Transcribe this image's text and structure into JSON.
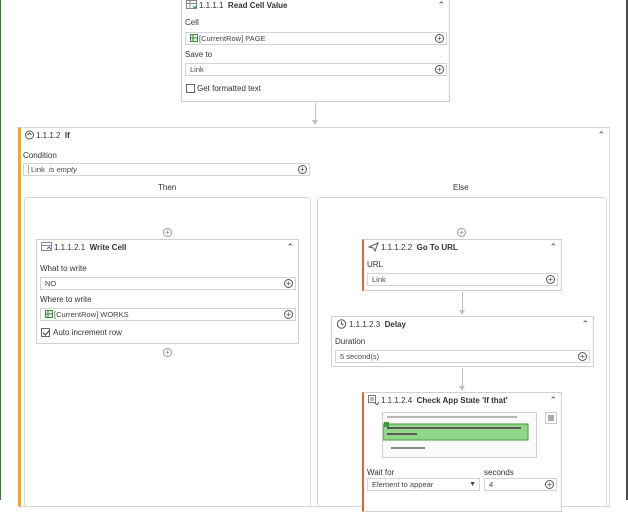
{
  "read_cell": {
    "number": "1.1.1.1",
    "title": "Read Cell Value",
    "cell_label": "Cell",
    "cell_value": "[CurrentRow] PAGE",
    "save_label": "Save to",
    "save_value": "Link",
    "formatted_label": "Get formatted text"
  },
  "if_step": {
    "number": "1.1.1.2",
    "title": "If",
    "condition_label": "Condition",
    "condition_var": "Link",
    "condition_op": "is empty",
    "then_label": "Then",
    "else_label": "Else"
  },
  "write_cell": {
    "number": "1.1.1.2.1",
    "title": "Write Cell",
    "what_label": "What to write",
    "what_value": "NO",
    "where_label": "Where to write",
    "where_value": "[CurrentRow] WORKS",
    "auto_label": "Auto increment row"
  },
  "go_url": {
    "number": "1.1.1.2.2",
    "title": "Go To URL",
    "url_label": "URL",
    "url_value": "Link"
  },
  "delay": {
    "number": "1.1.1.2.3",
    "title": "Delay",
    "duration_label": "Duration",
    "duration_value": "5 second(s)"
  },
  "check_app": {
    "number": "1.1.1.2.4",
    "title": "Check App State 'If that'",
    "wait_label": "Wait for",
    "wait_value": "Element to appear",
    "seconds_label": "seconds",
    "seconds_value": "4"
  },
  "colors": {
    "accent_orange": "#f5a623",
    "accent_red": "#e8622c",
    "preview_green": "#92d68a"
  }
}
